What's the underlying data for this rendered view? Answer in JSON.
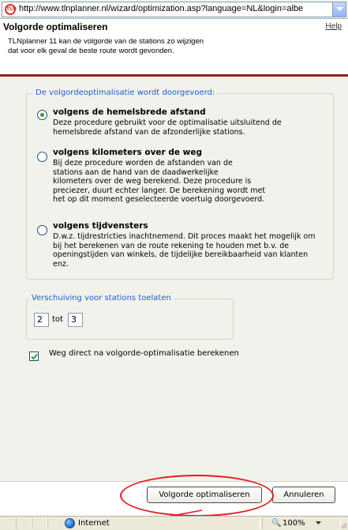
{
  "address_bar": {
    "url": "http://www.tlnplanner.nl/wizard/optimization.asp?language=NL&login=albe",
    "icon": "tln-page-icon"
  },
  "header": {
    "title": "Volgorde optimaliseren",
    "help": "Help",
    "description_line1": "TLNplanner 11 kan de volgorde van de stations zo wijzigen",
    "description_line2": "dat voor elk geval de beste route wordt gevonden."
  },
  "optimization": {
    "legend": "De volgordeoptimalisatie wordt doorgevoerd:",
    "options": [
      {
        "title": "volgens de hemelsbrede afstand",
        "lines": [
          "Deze procedure gebruikt voor de optimalisatie uitsluitend de",
          "hemelsbrede afstand van de afzonderlijke stations."
        ],
        "checked": true
      },
      {
        "title": "volgens kilometers over de weg",
        "lines": [
          "Bij deze procedure worden de afstanden van de",
          "stations aan de hand van de daadwerkelijke",
          "kilometers over de weg berekend. Deze procedure is",
          "preciezer, duurt echter langer. De berekening wordt met",
          "het op dit moment geselecteerde voertuig doorgevoerd."
        ],
        "checked": false
      },
      {
        "title": "volgens tijdvensters",
        "lines": [
          "D.w.z. tijdrestricties inachtnemend. Dit proces maakt het mogelijk om",
          "bij het berekenen van de route rekening te houden met b.v. de",
          "openingstijden van winkels, de tijdelijke bereikbaarheid van klanten",
          "enz."
        ],
        "checked": false
      }
    ]
  },
  "shift": {
    "legend": "Verschuiving voor stations toelaten",
    "from": "2",
    "to_label": "tot",
    "to": "3"
  },
  "checkbox": {
    "label": "Weg direct na volgorde-optimalisatie berekenen",
    "checked": true
  },
  "buttons": {
    "optimize": "Volgorde optimaliseren",
    "cancel": "Annuleren"
  },
  "status_bar": {
    "zone": "Internet",
    "zoom": "100%"
  },
  "colors": {
    "accent_blue": "#1f5ccf",
    "header_rule": "#9a1f1f",
    "highlight_red": "#e01f1f"
  }
}
